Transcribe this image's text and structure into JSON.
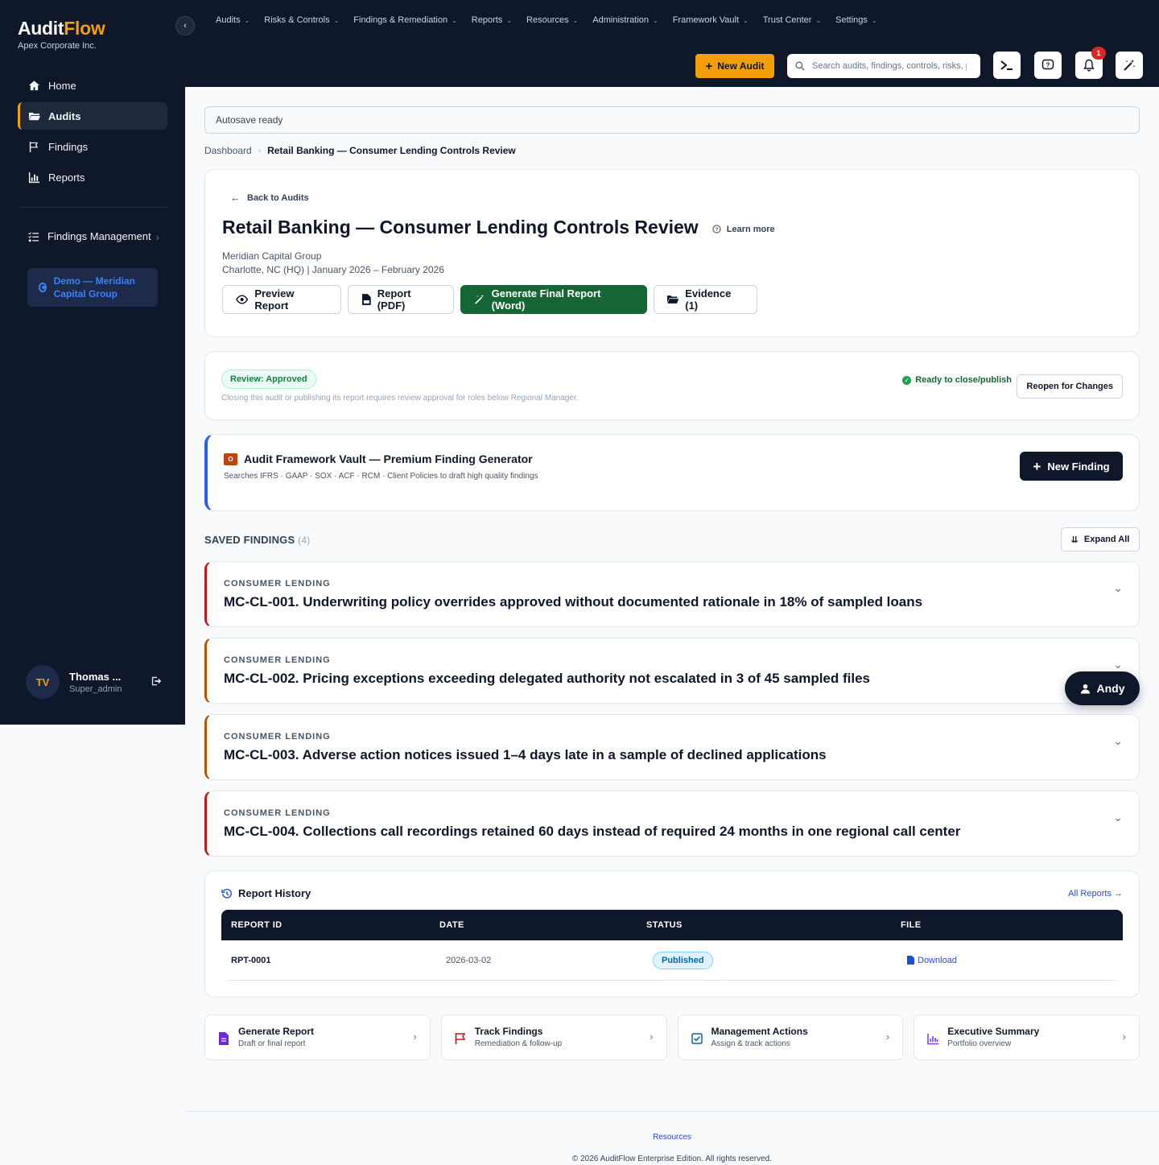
{
  "brand": {
    "name_part1": "Audit",
    "name_part2": "Flow",
    "org": "Apex Corporate Inc."
  },
  "sidebar": {
    "items": [
      {
        "label": "Home",
        "icon": "home-icon"
      },
      {
        "label": "Audits",
        "icon": "folder-icon",
        "active": true
      },
      {
        "label": "Findings",
        "icon": "flag-icon"
      },
      {
        "label": "Reports",
        "icon": "bar-chart-icon"
      }
    ],
    "findings_management": "Findings Management",
    "demo_label": "Demo — Meridian Capital Group",
    "user": {
      "initials": "TV",
      "name": "Thomas ...",
      "role": "Super_admin"
    }
  },
  "topbar": {
    "menu": [
      "Audits",
      "Risks & Controls",
      "Findings & Remediation",
      "Reports",
      "Resources",
      "Administration",
      "Framework Vault",
      "Trust Center",
      "Settings"
    ],
    "new_audit": "New Audit",
    "search_placeholder": "Search audits, findings, controls, risks, p",
    "notification_count": "1"
  },
  "autosave": "Autosave ready",
  "breadcrumb": {
    "root": "Dashboard",
    "current": "Retail Banking — Consumer Lending Controls Review"
  },
  "hero": {
    "back": "Back to Audits",
    "title": "Retail Banking — Consumer Lending Controls Review",
    "learn_more": "Learn more",
    "client": "Meridian Capital Group",
    "location_dates": "Charlotte, NC (HQ) | January 2026 – February 2026",
    "buttons": {
      "preview": "Preview Report",
      "pdf": "Report (PDF)",
      "word": "Generate Final Report (Word)",
      "evidence": "Evidence (1)"
    }
  },
  "review": {
    "status": "Review: Approved",
    "note": "Closing this audit or publishing its report requires review approval for roles below Regional Manager.",
    "ready": "Ready to close/publish",
    "reopen": "Reopen for Changes"
  },
  "vault": {
    "title": "Audit Framework Vault — Premium Finding Generator",
    "subtitle": "Searches IFRS · GAAP · SOX · ACF · RCM · Client Policies to draft high quality findings",
    "new_finding": "New Finding"
  },
  "saved": {
    "title": "SAVED FINDINGS",
    "count": "(4)",
    "expand_all": "Expand All",
    "findings": [
      {
        "category": "CONSUMER LENDING",
        "title": "MC-CL-001. Underwriting policy overrides approved without documented rationale in 18% of sampled loans",
        "severity_color": "#b91c1c"
      },
      {
        "category": "CONSUMER LENDING",
        "title": "MC-CL-002. Pricing exceptions exceeding delegated authority not escalated in 3 of 45 sampled files",
        "severity_color": "#b45309"
      },
      {
        "category": "CONSUMER LENDING",
        "title": "MC-CL-003. Adverse action notices issued 1–4 days late in a sample of declined applications",
        "severity_color": "#b45309"
      },
      {
        "category": "CONSUMER LENDING",
        "title": "MC-CL-004. Collections call recordings retained 60 days instead of required 24 months in one regional call center",
        "severity_color": "#b91c1c"
      }
    ]
  },
  "history": {
    "title": "Report History",
    "all_reports": "All Reports →",
    "columns": [
      "REPORT ID",
      "DATE",
      "STATUS",
      "FILE"
    ],
    "rows": [
      {
        "id": "RPT-0001",
        "date": "2026-03-02",
        "status": "Published",
        "file": "Download"
      }
    ]
  },
  "quick": [
    {
      "title": "Generate Report",
      "sub": "Draft or final report",
      "icon": "document-icon",
      "color": "#6d28d9"
    },
    {
      "title": "Track Findings",
      "sub": "Remediation & follow-up",
      "icon": "flag-icon",
      "color": "#b91c1c"
    },
    {
      "title": "Management Actions",
      "sub": "Assign & track actions",
      "icon": "checkbox-icon",
      "color": "#0369a1"
    },
    {
      "title": "Executive Summary",
      "sub": "Portfolio overview",
      "icon": "bar-chart-icon",
      "color": "#7c3aed"
    }
  ],
  "footer": {
    "resources": "Resources",
    "copyright": "© 2026 AuditFlow Enterprise Edition. All rights reserved."
  },
  "assistant": "Andy"
}
